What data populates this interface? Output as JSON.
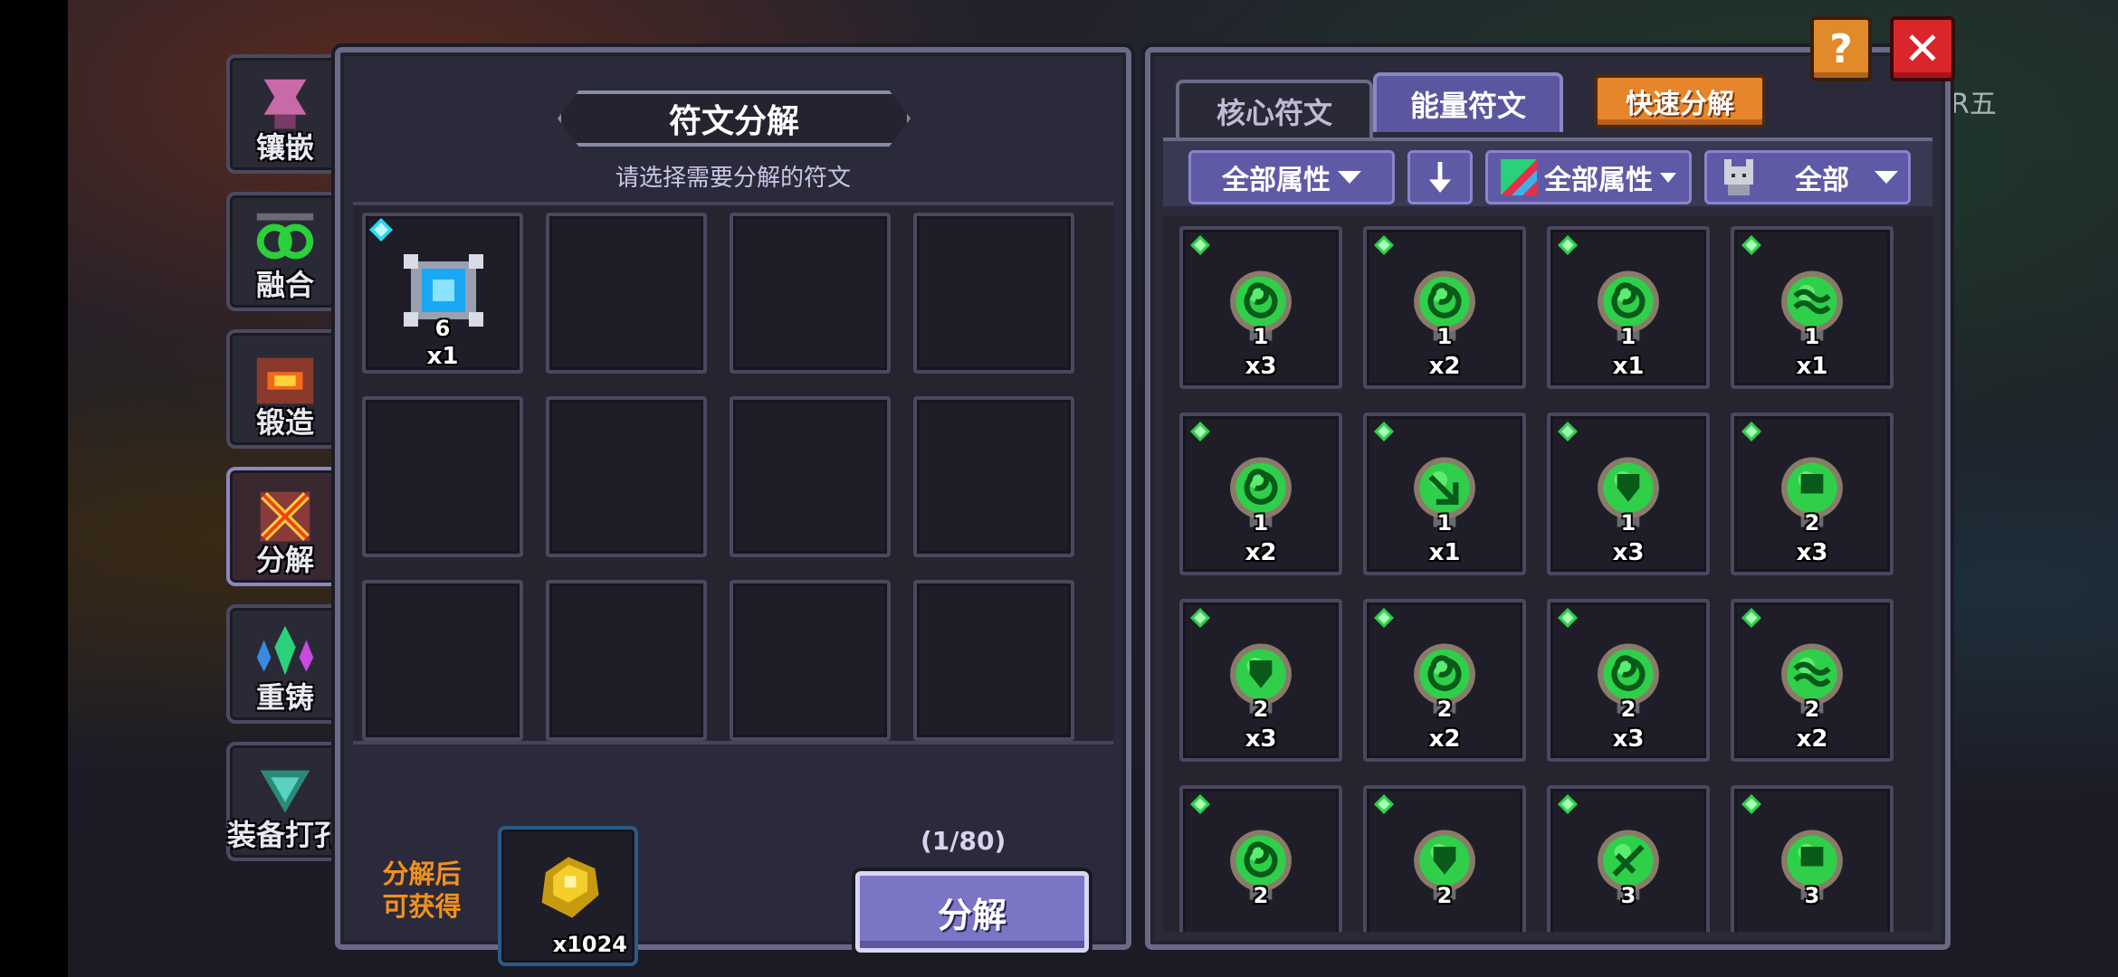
{
  "background": {
    "side_text": "R五"
  },
  "nav": {
    "items": [
      {
        "label": "镶嵌",
        "icon": "inlay-icon"
      },
      {
        "label": "融合",
        "icon": "fusion-icon"
      },
      {
        "label": "锻造",
        "icon": "forge-icon"
      },
      {
        "label": "分解",
        "icon": "decompose-icon",
        "active": true
      },
      {
        "label": "重铸",
        "icon": "recast-icon"
      },
      {
        "label": "装备打孔",
        "icon": "socket-icon"
      }
    ]
  },
  "decompose_panel": {
    "title": "符文分解",
    "subtitle": "请选择需要分解的符文",
    "selected_slot": {
      "level": "6",
      "count": "x1"
    },
    "reward_label_line1": "分解后",
    "reward_label_line2": "可获得",
    "reward_count": "x1024",
    "capacity": "(1/80)",
    "decompose_button": "分解"
  },
  "rune_panel": {
    "tabs": [
      {
        "label": "核心符文",
        "active": false
      },
      {
        "label": "能量符文",
        "active": true
      }
    ],
    "quick_button": "快速分解",
    "filters": {
      "attr1": "全部属性",
      "attr2": "全部属性",
      "type": "全部"
    },
    "runes": [
      {
        "level": "1",
        "count": "x3"
      },
      {
        "level": "1",
        "count": "x2"
      },
      {
        "level": "1",
        "count": "x1"
      },
      {
        "level": "1",
        "count": "x1"
      },
      {
        "level": "1",
        "count": "x2"
      },
      {
        "level": "1",
        "count": "x1"
      },
      {
        "level": "1",
        "count": "x3"
      },
      {
        "level": "2",
        "count": "x3"
      },
      {
        "level": "2",
        "count": "x3"
      },
      {
        "level": "2",
        "count": "x2"
      },
      {
        "level": "2",
        "count": "x3"
      },
      {
        "level": "2",
        "count": "x2"
      },
      {
        "level": "2",
        "count": ""
      },
      {
        "level": "2",
        "count": ""
      },
      {
        "level": "3",
        "count": ""
      },
      {
        "level": "3",
        "count": ""
      }
    ]
  },
  "top_buttons": {
    "help": "?",
    "close": "✕"
  },
  "colors": {
    "accent_purple": "#7a75c4",
    "quick_orange": "#e6852a",
    "close_red": "#d9262a",
    "rune_green": "#2fcf4a",
    "reward_label": "#f2901e"
  }
}
